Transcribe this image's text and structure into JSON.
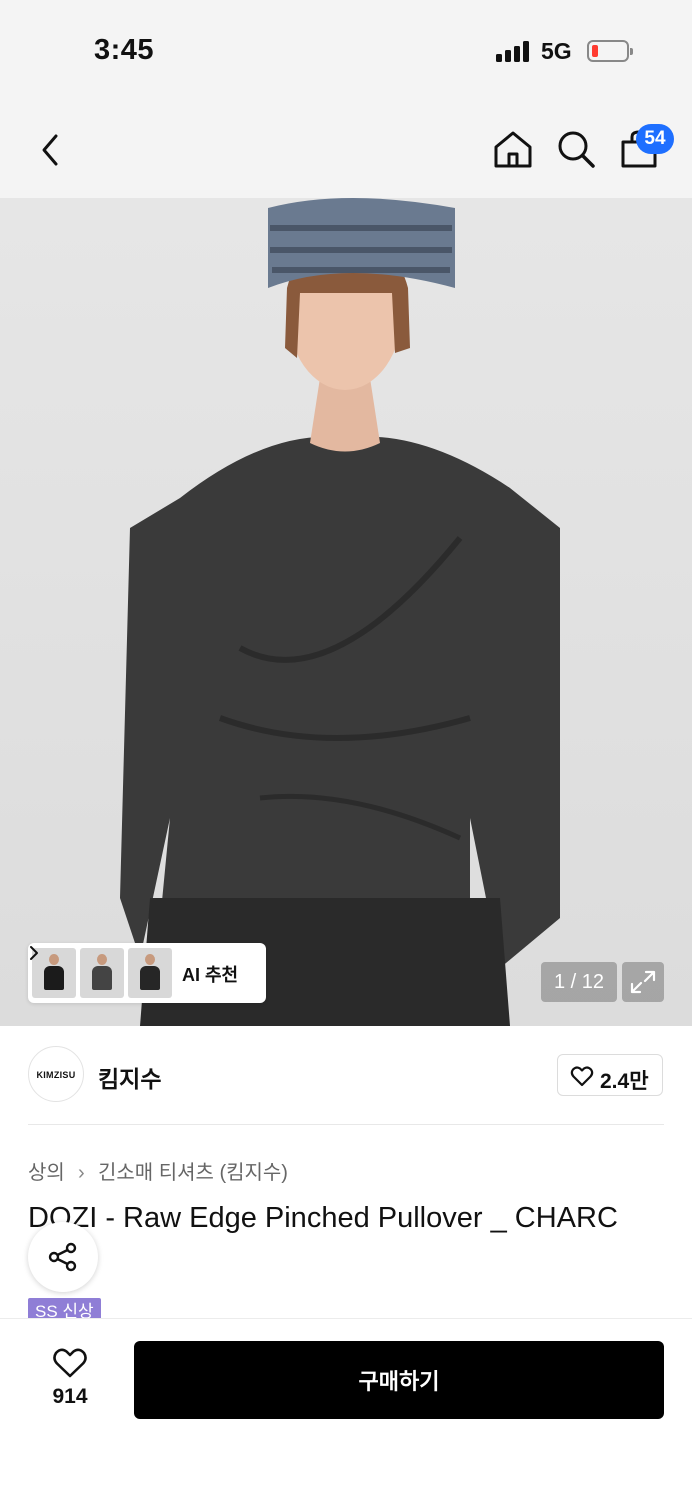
{
  "status_bar": {
    "time": "3:45",
    "network": "5G",
    "battery_level": 0.15
  },
  "header": {
    "cart_badge": "54",
    "icons": [
      "back-icon",
      "home-icon",
      "search-icon",
      "bag-icon"
    ]
  },
  "gallery": {
    "ai_label": "AI 추천",
    "page_indicator": "1 / 12",
    "thumbnail_count": 3
  },
  "brand": {
    "logo_text": "KIMZISU",
    "name": "킴지수",
    "likes": "2.4만"
  },
  "breadcrumb": [
    "상의",
    "긴소매 티셔츠 (킴지수)"
  ],
  "product": {
    "title": "DOZI - Raw Edge Pinched Pullover _ CHARC",
    "tag": "SS 신상"
  },
  "bottom_bar": {
    "wish_count": "914",
    "buy_label": "구매하기"
  },
  "colors": {
    "badge": "#1e6fff",
    "tag": "#8f7ed6",
    "buy_button": "#000000"
  }
}
